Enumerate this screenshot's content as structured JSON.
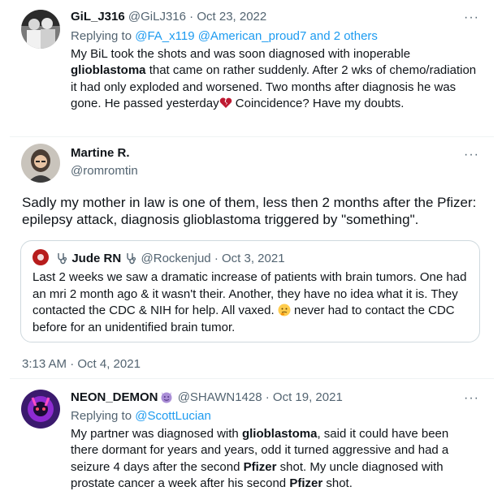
{
  "tweet1": {
    "name": "GiL_J316",
    "handle": "@GiLJ316",
    "sep": "·",
    "date": "Oct 23, 2022",
    "replying_prefix": "Replying to",
    "replying_users": "@FA_x119 @American_proud7",
    "replying_and": "and 2 others",
    "text_1": "My BiL took the shots and was soon diagnosed with inoperable",
    "text_bold": "glioblastoma",
    "text_2": "that came on rather suddenly. After 2 wks of chemo/radiation it had only exploded and worsened. Two months after diagnosis he was gone. He passed yesterday",
    "text_3": "Coincidence? Have my doubts.",
    "more": "···",
    "emoji": "broken-heart-icon"
  },
  "tweet2": {
    "name": "Martine R.",
    "handle": "@romromtin",
    "text": "Sadly my mother in law is one of them, less then 2 months after the Pfizer:  epilepsy attack, diagnosis glioblastoma triggered by \"something\".",
    "timestamp": "3:13 AM · Oct 4, 2021",
    "more": "···",
    "quote": {
      "name": "Jude RN",
      "handle": "@Rockenjud",
      "sep": "·",
      "date": "Oct 3, 2021",
      "text_1": "Last 2 weeks we saw a dramatic increase of patients with brain tumors. One had an mri 2 month ago & it wasn't their. Another, they have no idea what it is. They contacted the CDC & NIH for help. All vaxed.",
      "text_2": "never had to contact the CDC before for an unidentified brain tumor.",
      "emoji": "thinking-face-icon"
    }
  },
  "tweet3": {
    "name": "NEON_DEMON",
    "handle": "@SHAWN1428",
    "sep": "·",
    "date": "Oct 19, 2021",
    "replying_prefix": "Replying to",
    "replying_user": "@ScottLucian",
    "text_1": "My partner was diagnosed with",
    "text_b1": "glioblastoma",
    "text_2": ", said it could have been there dormant for years and years, odd it turned aggressive and had a seizure 4 days after the second",
    "text_b2": "Pfizer",
    "text_3": "shot. My uncle diagnosed with prostate cancer a week after his second",
    "text_b3": "Pfizer",
    "text_4": "shot.",
    "more": "···",
    "emoji": "smiling-devil-icon"
  },
  "colors": {
    "link": "#1d9bf0",
    "muted": "#536471",
    "text": "#0f1419",
    "border": "#cfd9de"
  }
}
